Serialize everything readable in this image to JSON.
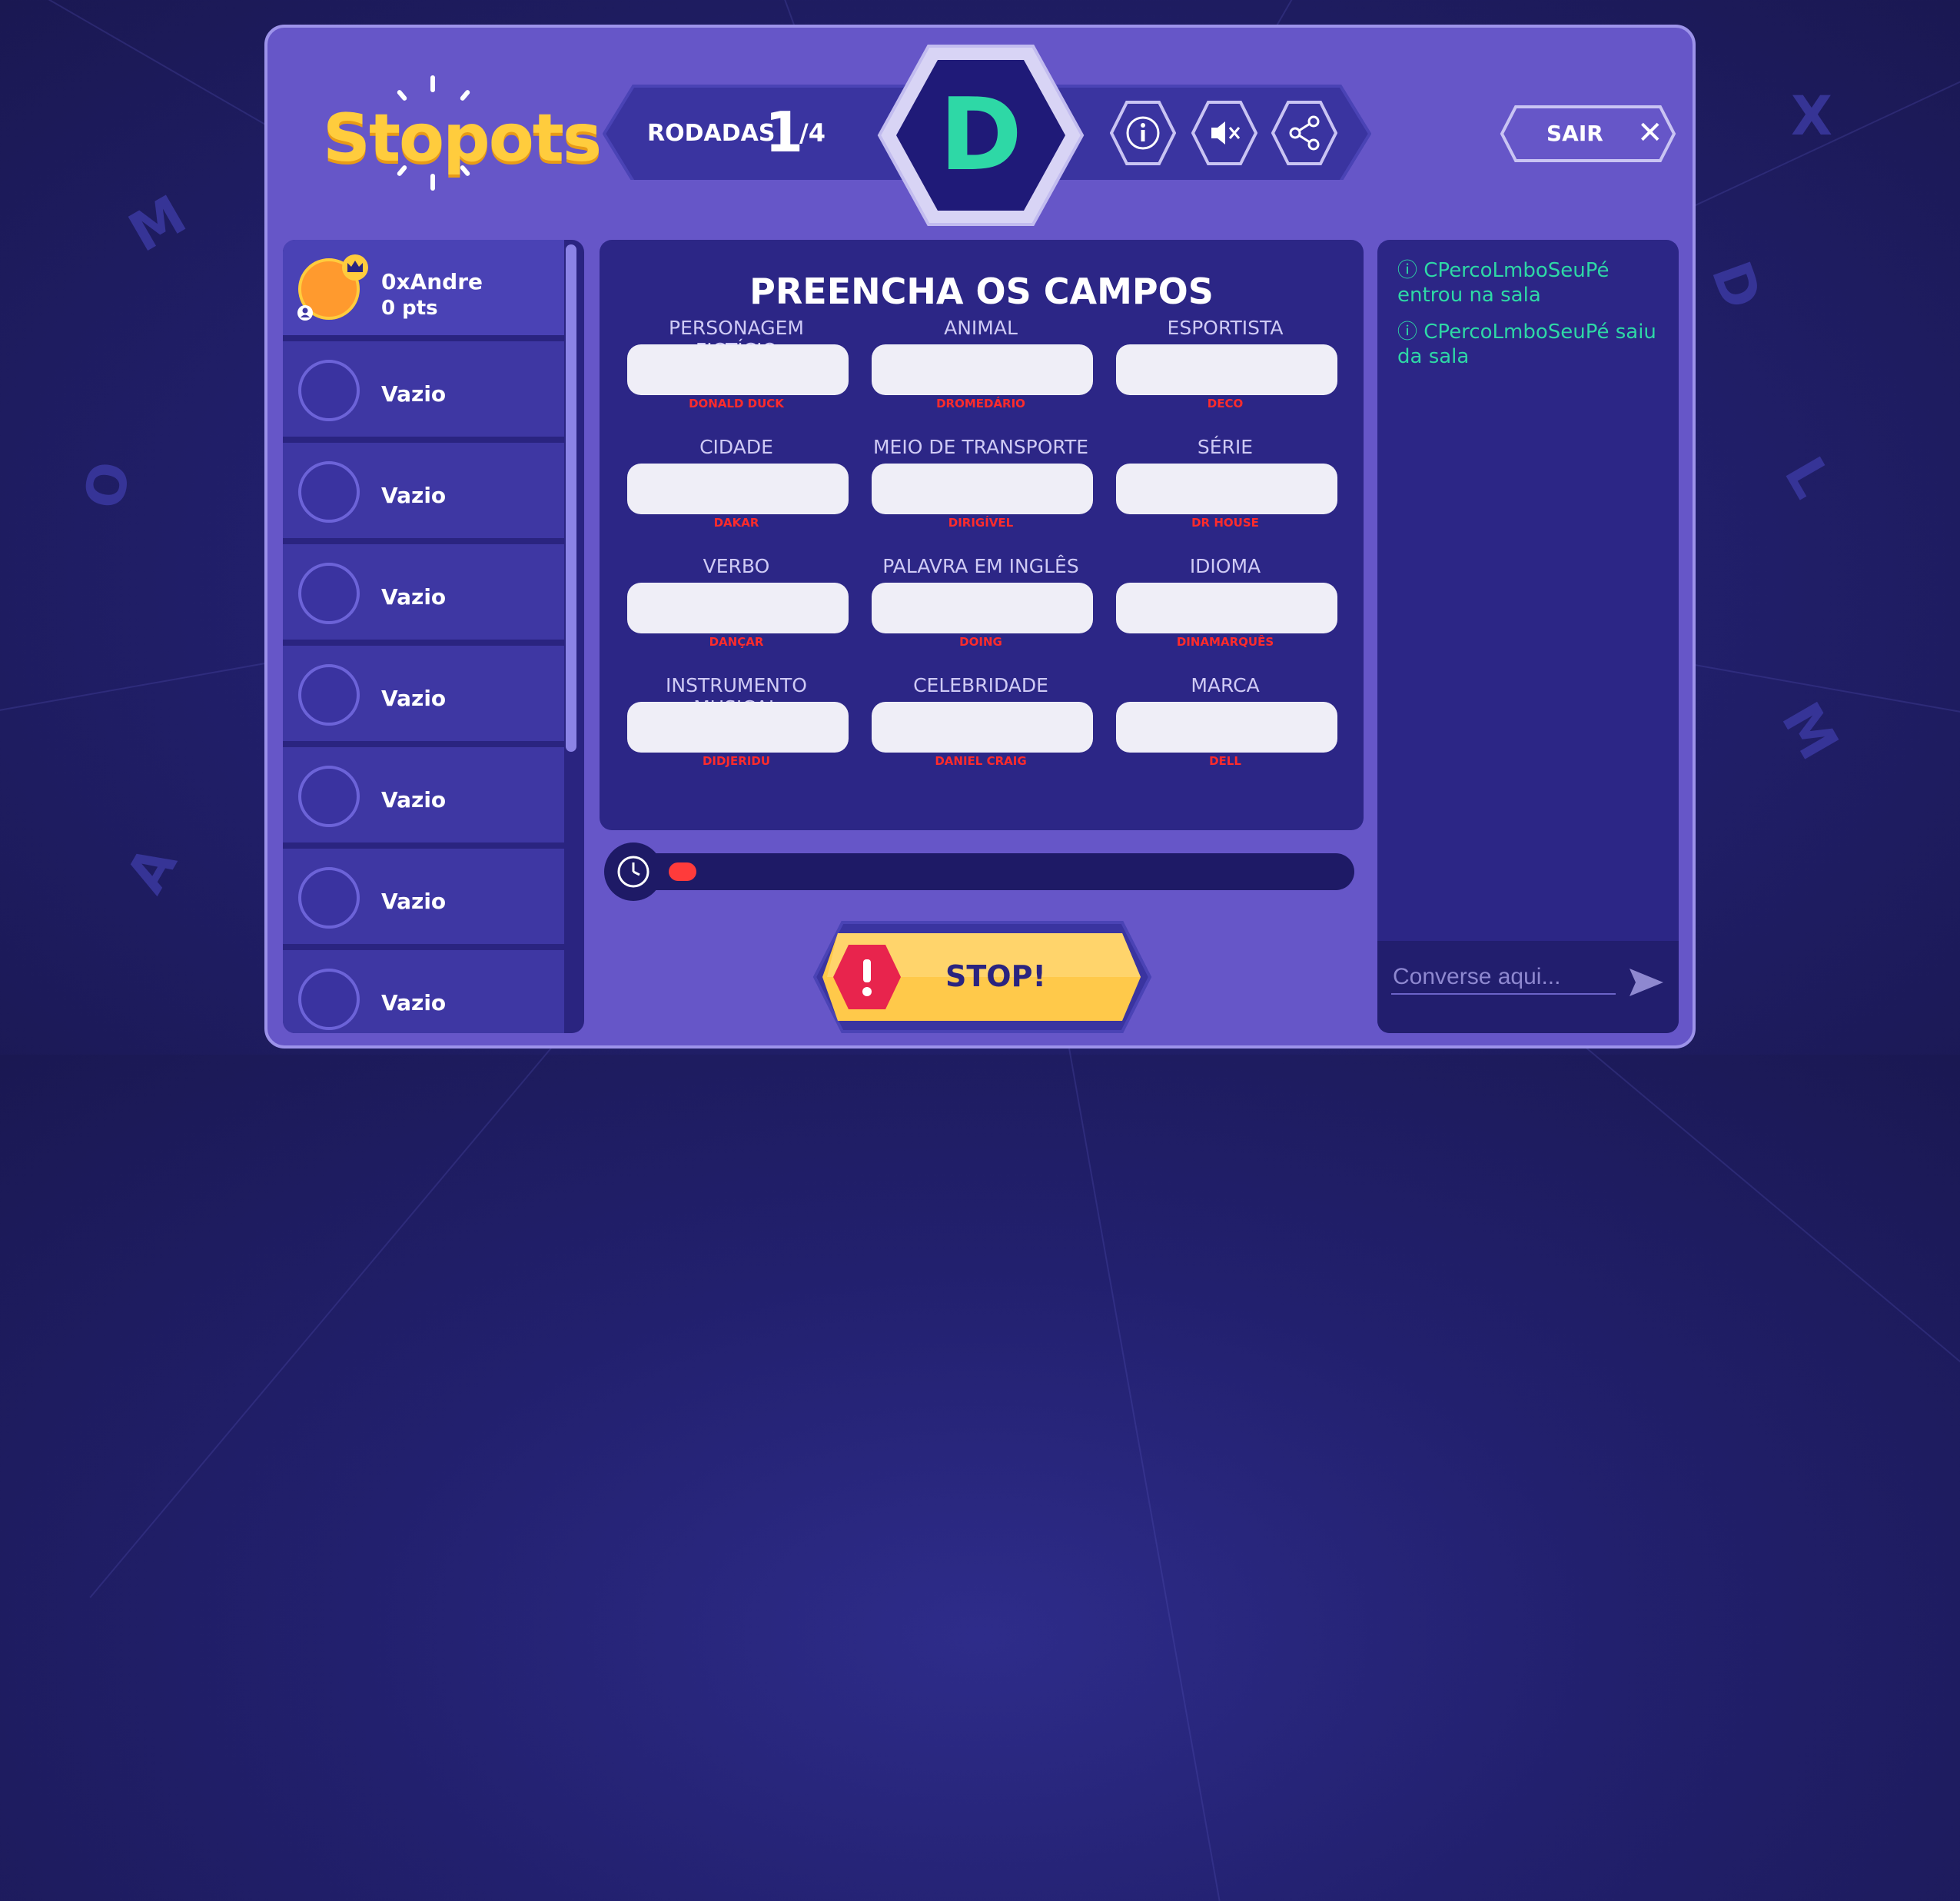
{
  "app": {
    "logo": "Stopots"
  },
  "round": {
    "label": "RODADAS",
    "current": "1",
    "total": "/4",
    "letter": "D"
  },
  "top_icons": [
    {
      "icon": "info-icon",
      "symbol": "i"
    },
    {
      "icon": "mute-icon",
      "symbol": "🔇"
    },
    {
      "icon": "share-icon",
      "symbol": "share"
    }
  ],
  "exit": {
    "label": "SAIR",
    "icon": "close-icon"
  },
  "players": [
    {
      "name": "0xAndre",
      "points": "0 pts"
    },
    {
      "name": "Vazio"
    },
    {
      "name": "Vazio"
    },
    {
      "name": "Vazio"
    },
    {
      "name": "Vazio"
    },
    {
      "name": "Vazio"
    },
    {
      "name": "Vazio"
    },
    {
      "name": "Vazio"
    }
  ],
  "form": {
    "title": "PREENCHA OS CAMPOS",
    "fields": [
      {
        "label": "PERSONAGEM FICTÍCIO",
        "hint": "DONALD DUCK",
        "value": ""
      },
      {
        "label": "ANIMAL",
        "hint": "DROMEDÁRIO",
        "value": ""
      },
      {
        "label": "ESPORTISTA",
        "hint": "DECO",
        "value": ""
      },
      {
        "label": "CIDADE",
        "hint": "DAKAR",
        "value": ""
      },
      {
        "label": "MEIO DE TRANSPORTE",
        "hint": "DIRIGÍVEL",
        "value": ""
      },
      {
        "label": "SÉRIE",
        "hint": "DR HOUSE",
        "value": ""
      },
      {
        "label": "VERBO",
        "hint": "DANÇAR",
        "value": ""
      },
      {
        "label": "PALAVRA EM INGLÊS",
        "hint": "DOING",
        "value": ""
      },
      {
        "label": "IDIOMA",
        "hint": "DINAMARQUÊS",
        "value": ""
      },
      {
        "label": "INSTRUMENTO MUSICAL",
        "hint": "DIDJERIDU",
        "value": ""
      },
      {
        "label": "CELEBRIDADE",
        "hint": "DANIEL CRAIG",
        "value": ""
      },
      {
        "label": "MARCA",
        "hint": "DELL",
        "value": ""
      }
    ]
  },
  "timer": {
    "icon": "clock-icon",
    "progress": 0.04
  },
  "stop_button": {
    "label": "STOP!",
    "icon": "alert-icon"
  },
  "chat": {
    "messages": [
      {
        "user": "CPercoLmboSeuPé",
        "action": "entrou na sala"
      },
      {
        "user": "CPercoLmboSeuPé",
        "action": "saiu da sala"
      }
    ],
    "placeholder": "Converse aqui...",
    "send_icon": "send-icon"
  },
  "colors": {
    "background": "#22206e",
    "panel": "#6656c8",
    "letter": "#2ed8a6",
    "logo": "#ffcc3d",
    "hint": "#ff2b2b",
    "stop": "#ffc94a"
  }
}
